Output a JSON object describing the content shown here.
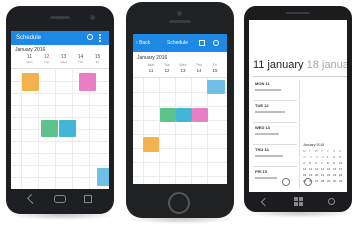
{
  "colors": {
    "accent": "#1e88e5",
    "event_orange": "#f4b24e",
    "event_pink": "#e87fc4",
    "event_green": "#5cc48b",
    "event_teal": "#43b6d8",
    "event_sky": "#6fbfe6",
    "sunday_red": "#e53935"
  },
  "android": {
    "app_title": "Schedule",
    "month": "January 2016",
    "days": [
      {
        "num": "11",
        "name": "Mon"
      },
      {
        "num": "12",
        "name": "Tue"
      },
      {
        "num": "13",
        "name": "Wed"
      },
      {
        "num": "14",
        "name": "Thu"
      },
      {
        "num": "15",
        "name": "Fri"
      }
    ],
    "icons": [
      "search-icon",
      "menu-icon"
    ],
    "nav_icons": [
      "back-icon",
      "home-icon",
      "recents-icon"
    ]
  },
  "iphone": {
    "back_label": "Back",
    "app_title": "Schedule",
    "month": "January 2016",
    "days": [
      {
        "num": "Mon",
        "name": "11"
      },
      {
        "num": "Tue",
        "name": "12"
      },
      {
        "num": "Wed",
        "name": "13"
      },
      {
        "num": "Thu",
        "name": "14"
      },
      {
        "num": "Fri",
        "name": "15"
      }
    ]
  },
  "winphone": {
    "date_primary": "11 january",
    "date_secondary": "18 january",
    "list": [
      {
        "day": "MON 11"
      },
      {
        "day": "TUE 12"
      },
      {
        "day": "WED 13"
      },
      {
        "day": "THU 14"
      },
      {
        "day": "FRI 15"
      }
    ],
    "mini_month": "January 2016",
    "mini_weekdays": [
      "M",
      "T",
      "W",
      "T",
      "F",
      "S",
      "S"
    ],
    "mini_days": [
      "28",
      "29",
      "30",
      "31",
      "1",
      "2",
      "3",
      "4",
      "5",
      "6",
      "7",
      "8",
      "9",
      "10",
      "11",
      "12",
      "13",
      "14",
      "15",
      "16",
      "17",
      "18",
      "19",
      "20",
      "21",
      "22",
      "23",
      "24",
      "25",
      "26",
      "27",
      "28",
      "29",
      "30",
      "31"
    ]
  }
}
